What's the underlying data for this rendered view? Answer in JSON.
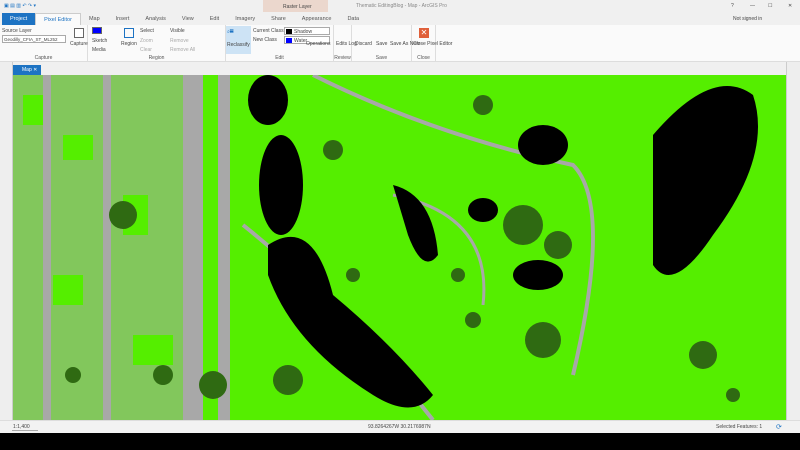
{
  "window": {
    "title": "Thematic EditingBlog - Map - ArcGIS Pro",
    "help": "?",
    "minimize": "—",
    "maximize": "☐",
    "close": "✕",
    "user": "Not signed in",
    "context_tab_group": "Raster Layer"
  },
  "tabs": [
    "Project",
    "Pixel Editor",
    "Map",
    "Insert",
    "Analysis",
    "View",
    "Edit",
    "Imagery",
    "Share",
    "Appearance",
    "Data"
  ],
  "ribbon": {
    "capture": {
      "source_layer_label": "Source Layer",
      "source_layer_value": "Geodilly_CFIA_ST_ML252",
      "capture": "Capture",
      "label": "Capture"
    },
    "region": {
      "sketch": "Sketch",
      "media": "Media",
      "region": "Region",
      "select": "Select",
      "visible": "Visible",
      "zoom": "Zoom",
      "remove": "Remove",
      "clear": "Clear",
      "remove_all": "Remove All",
      "label": "Region",
      "swatch_color": "#0000ff"
    },
    "edit": {
      "reclassify": "Reclassify",
      "current_class": "Current Class",
      "new_class": "New Class",
      "current_class_value": "Shadow",
      "new_class_value": "Water",
      "current_class_color": "#000000",
      "new_class_color": "#0000ff",
      "operations": "Operations",
      "label": "Edit"
    },
    "review": {
      "edits_log": "Edits Log",
      "label": "Review"
    },
    "save": {
      "discard": "Discard",
      "save": "Save",
      "save_as": "Save As New",
      "label": "Save"
    },
    "close": {
      "close_editor": "Close Pixel Editor",
      "label": "Close"
    }
  },
  "map_tab": "Map",
  "map_colors": {
    "vegetation": "#55ee00",
    "water": "#000000",
    "impervious": "#a8a8a8",
    "trees": "#2f6a12"
  },
  "status": {
    "scale": "1:1,400",
    "coordinates": "93.8264267W 30.2176987N",
    "selected_features": "Selected Features: 1"
  }
}
